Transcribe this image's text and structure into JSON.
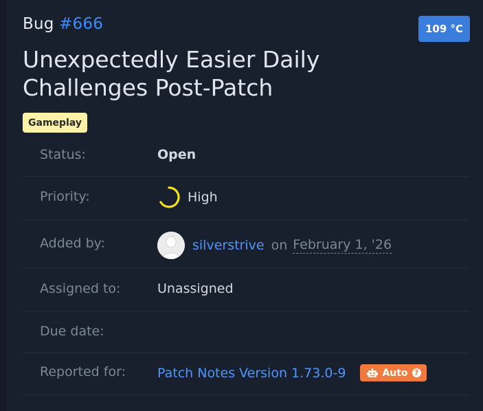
{
  "bug": {
    "prefix": "Bug",
    "number": "#666"
  },
  "badge": {
    "temperature": "109 °C"
  },
  "title": "Unexpectedly Easier Daily Challenges Post-Patch",
  "tag": "Gameplay",
  "fields": {
    "status": {
      "label": "Status:",
      "value": "Open"
    },
    "priority": {
      "label": "Priority:",
      "value": "High",
      "icon": "priority-ring-icon",
      "color": "#f5e21b"
    },
    "added_by": {
      "label": "Added by:",
      "user": "silverstrive",
      "on": "on",
      "date": "February 1, '26"
    },
    "assigned_to": {
      "label": "Assigned to:",
      "value": "Unassigned"
    },
    "due_date": {
      "label": "Due date:",
      "value": ""
    },
    "reported_for": {
      "label": "Reported for:",
      "value": "Patch Notes Version 1.73.0-9",
      "auto_label": "Auto",
      "auto_icon": "robot-icon",
      "help_icon": "question-circle-icon"
    }
  },
  "colors": {
    "accent": "#3d8bff",
    "badge": "#3b7ddd",
    "tag": "#fdf2a8",
    "auto": "#f17a3f",
    "status_open": "#35b6f5"
  }
}
